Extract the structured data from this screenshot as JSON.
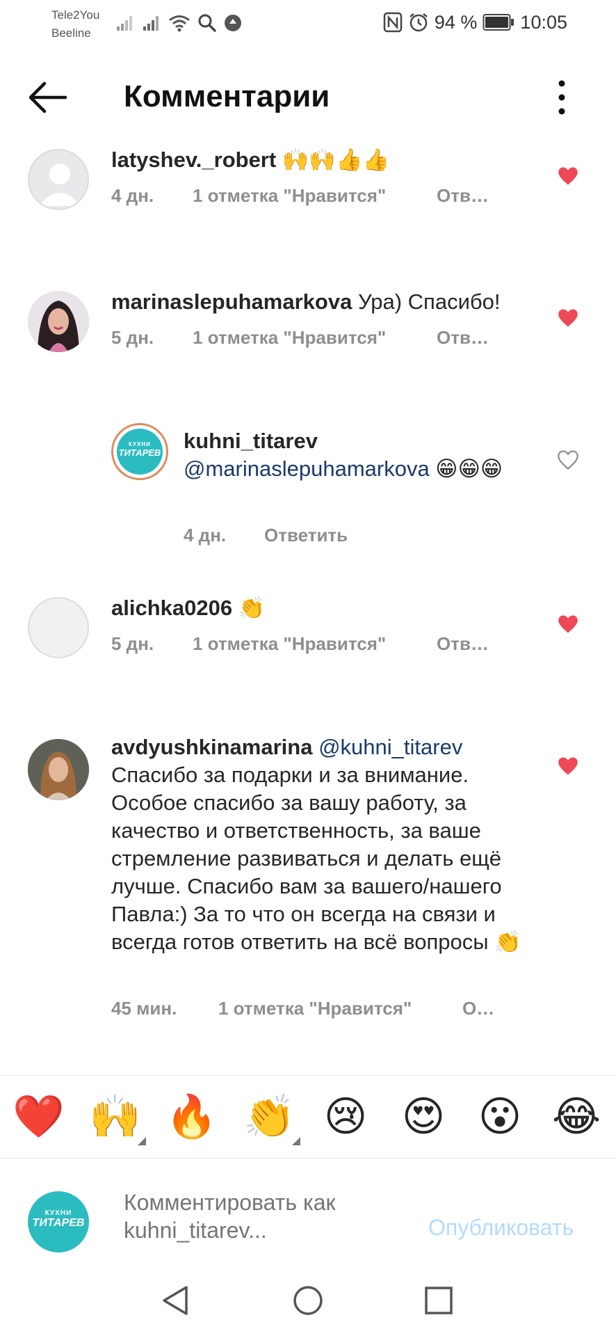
{
  "status_bar": {
    "carrier_1": "Tele2You",
    "carrier_2": "Beeline",
    "battery": "94 %",
    "time": "10:05"
  },
  "header": {
    "title": "Комментарии"
  },
  "comments": [
    {
      "username": "latyshev._robert",
      "text": " 🙌🙌👍👍",
      "time": "4 дн.",
      "likes": "1 отметка \"Нравится\"",
      "reply": "Отв…",
      "liked": true
    },
    {
      "username": "marinaslepuhamarkova",
      "text": " Ура) Спасибо!",
      "time": "5 дн.",
      "likes": "1 отметка \"Нравится\"",
      "reply": "Отв…",
      "liked": true
    },
    {
      "username": "kuhni_titarev",
      "mention": "@marinaslepuhamarkova",
      "text": " 😁😁😁",
      "time": "4 дн.",
      "reply": "Ответить",
      "liked": false,
      "avatar_text_1": "КУХНИ",
      "avatar_text_2": "ТИТАРЕВ"
    },
    {
      "username": "alichka0206",
      "text": " 👏",
      "time": "5 дн.",
      "likes": "1 отметка \"Нравится\"",
      "reply": "Отв…",
      "liked": true
    },
    {
      "username": "avdyushkinamarina",
      "mention": " @kuhni_titarev",
      "text": " Спасибо за подарки и за внимание. Особое спасибо за вашу работу, за качество и ответственность, за ваше стремление развиваться и делать ещё лучше. Спасибо вам за вашего/нашего Павла:) За то что он всегда на связи и всегда готов ответить на всё вопросы 👏",
      "time": "45 мин.",
      "likes": "1 отметка \"Нравится\"",
      "reply": "О…",
      "liked": true
    }
  ],
  "reactions": [
    "❤️",
    "🙌",
    "🔥",
    "👏",
    "😢",
    "😍",
    "😮",
    "😂"
  ],
  "composer": {
    "placeholder": "Комментировать как kuhni_titarev...",
    "publish_label": "Опубликовать",
    "avatar_text_1": "КУХНИ",
    "avatar_text_2": "ТИТАРЕВ"
  },
  "colors": {
    "heart_red": "#ed4956",
    "link_blue": "#b3dbff",
    "mention_blue": "#1a3a6b",
    "brand_teal": "#2bbcc0"
  }
}
